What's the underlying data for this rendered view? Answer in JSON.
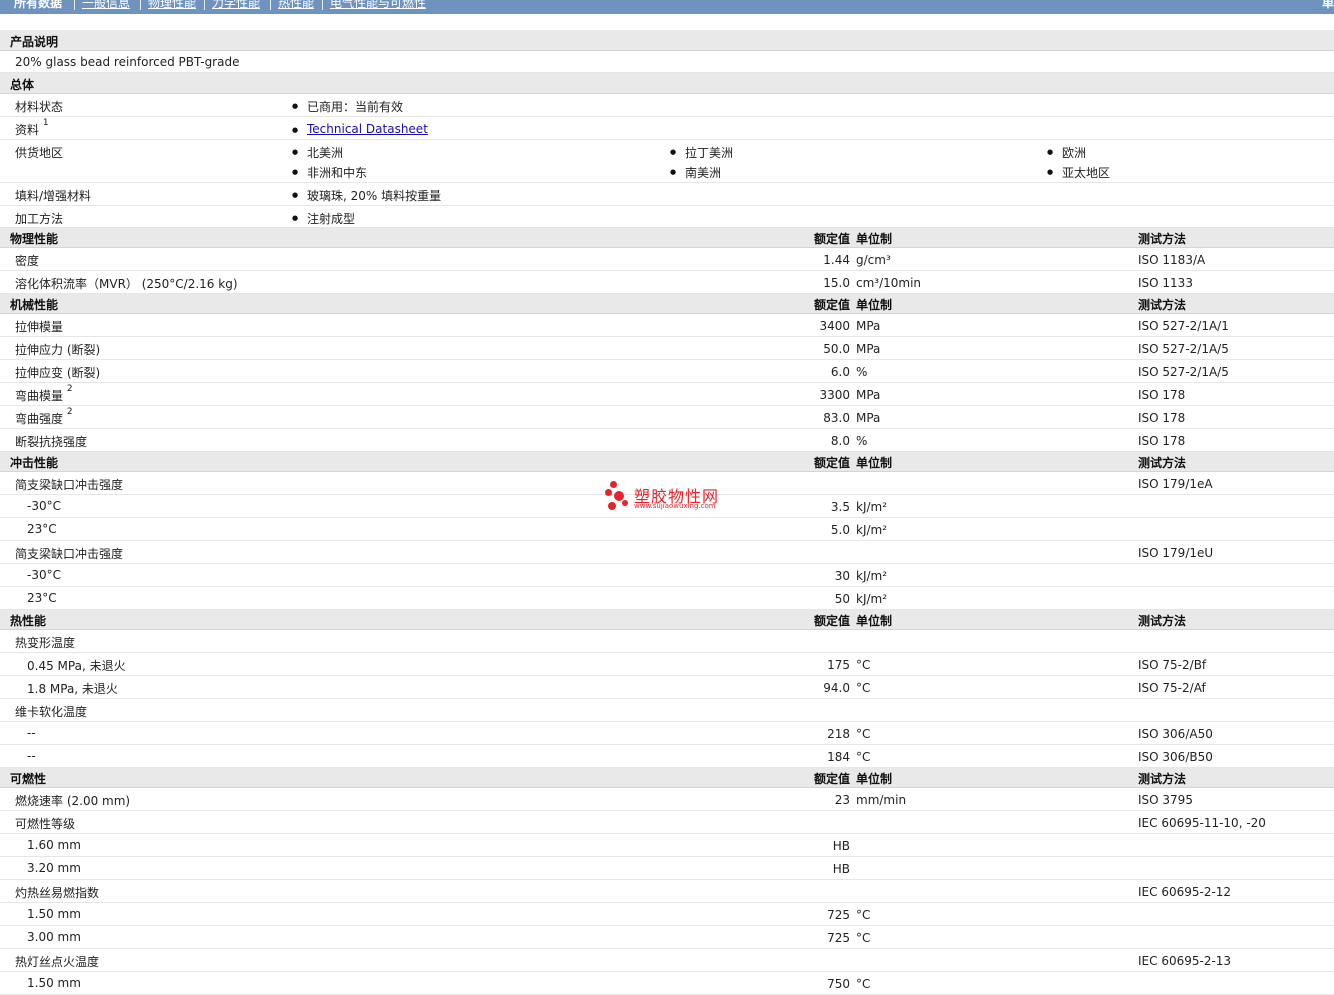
{
  "nav": {
    "items": [
      "所有数据",
      "一般信息",
      "物理性能",
      "力学性能",
      "热性能",
      "电气性能与可燃性"
    ],
    "right_label": "单"
  },
  "hdr": {
    "nominal": "额定值",
    "unit": "单位制",
    "test": "测试方法"
  },
  "product": {
    "section_title": "产品说明",
    "description": "20% glass bead reinforced PBT-grade"
  },
  "general": {
    "section_title": "总体",
    "status_label": "材料状态",
    "status_value": "已商用：当前有效",
    "resources_label": "资料",
    "resources_sup": "1",
    "resources_link": "Technical Datasheet",
    "supply_label": "供货地区",
    "supply_regions": [
      "北美洲",
      "拉丁美洲",
      "欧洲",
      "非洲和中东",
      "南美洲",
      "亚太地区"
    ],
    "filler_label": "填料/增强材料",
    "filler_value": "玻璃珠, 20% 填料按重量",
    "process_label": "加工方法",
    "process_value": "注射成型"
  },
  "physical": {
    "section_title": "物理性能",
    "rows": [
      {
        "label": "密度",
        "value": "1.44",
        "unit": "g/cm³",
        "method": "ISO 1183/A"
      },
      {
        "label": "溶化体积流率（MVR） (250°C/2.16 kg)",
        "value": "15.0",
        "unit": "cm³/10min",
        "method": "ISO 1133"
      }
    ]
  },
  "mechanical": {
    "section_title": "机械性能",
    "rows": [
      {
        "label": "拉伸模量",
        "value": "3400",
        "unit": "MPa",
        "method": "ISO 527-2/1A/1"
      },
      {
        "label": "拉伸应力 (断裂)",
        "value": "50.0",
        "unit": "MPa",
        "method": "ISO 527-2/1A/5"
      },
      {
        "label": "拉伸应变 (断裂)",
        "value": "6.0",
        "unit": "%",
        "method": "ISO 527-2/1A/5"
      },
      {
        "label": "弯曲模量",
        "sup": "2",
        "value": "3300",
        "unit": "MPa",
        "method": "ISO 178"
      },
      {
        "label": "弯曲强度",
        "sup": "2",
        "value": "83.0",
        "unit": "MPa",
        "method": "ISO 178"
      },
      {
        "label": "断裂抗挠强度",
        "value": "8.0",
        "unit": "%",
        "method": "ISO 178"
      }
    ]
  },
  "impact": {
    "section_title": "冲击性能",
    "rows": [
      {
        "label": "简支梁缺口冲击强度",
        "method": "ISO 179/1eA"
      },
      {
        "label": "-30°C",
        "value": "3.5",
        "unit": "kJ/m²",
        "indent": true
      },
      {
        "label": "23°C",
        "value": "5.0",
        "unit": "kJ/m²",
        "indent": true
      },
      {
        "label": "简支梁缺口冲击强度",
        "method": "ISO 179/1eU"
      },
      {
        "label": "-30°C",
        "value": "30",
        "unit": "kJ/m²",
        "indent": true
      },
      {
        "label": "23°C",
        "value": "50",
        "unit": "kJ/m²",
        "indent": true
      }
    ]
  },
  "thermal": {
    "section_title": "热性能",
    "rows": [
      {
        "label": "热变形温度"
      },
      {
        "label": "0.45 MPa, 未退火",
        "value": "175",
        "unit": "°C",
        "method": "ISO 75-2/Bf",
        "indent": true
      },
      {
        "label": "1.8 MPa, 未退火",
        "value": "94.0",
        "unit": "°C",
        "method": "ISO 75-2/Af",
        "indent": true
      },
      {
        "label": "维卡软化温度"
      },
      {
        "label": "--",
        "value": "218",
        "unit": "°C",
        "method": "ISO 306/A50",
        "indent": true
      },
      {
        "label": "--",
        "value": "184",
        "unit": "°C",
        "method": "ISO 306/B50",
        "indent": true
      }
    ]
  },
  "flammability": {
    "section_title": "可燃性",
    "rows": [
      {
        "label": "燃烧速率 (2.00 mm)",
        "value": "23",
        "unit": "mm/min",
        "method": "ISO 3795"
      },
      {
        "label": "可燃性等级",
        "method": "IEC 60695-11-10, -20"
      },
      {
        "label": "1.60 mm",
        "value": "HB",
        "indent": true
      },
      {
        "label": "3.20 mm",
        "value": "HB",
        "indent": true
      },
      {
        "label": "灼热丝易燃指数",
        "method": "IEC 60695-2-12"
      },
      {
        "label": "1.50 mm",
        "value": "725",
        "unit": "°C",
        "indent": true
      },
      {
        "label": "3.00 mm",
        "value": "725",
        "unit": "°C",
        "indent": true
      },
      {
        "label": "热灯丝点火温度",
        "method": "IEC 60695-2-13"
      },
      {
        "label": "1.50 mm",
        "value": "750",
        "unit": "°C",
        "indent": true
      }
    ]
  },
  "watermark": {
    "text": "塑胶物性网",
    "url": "www.sujiaowuxing.com"
  }
}
